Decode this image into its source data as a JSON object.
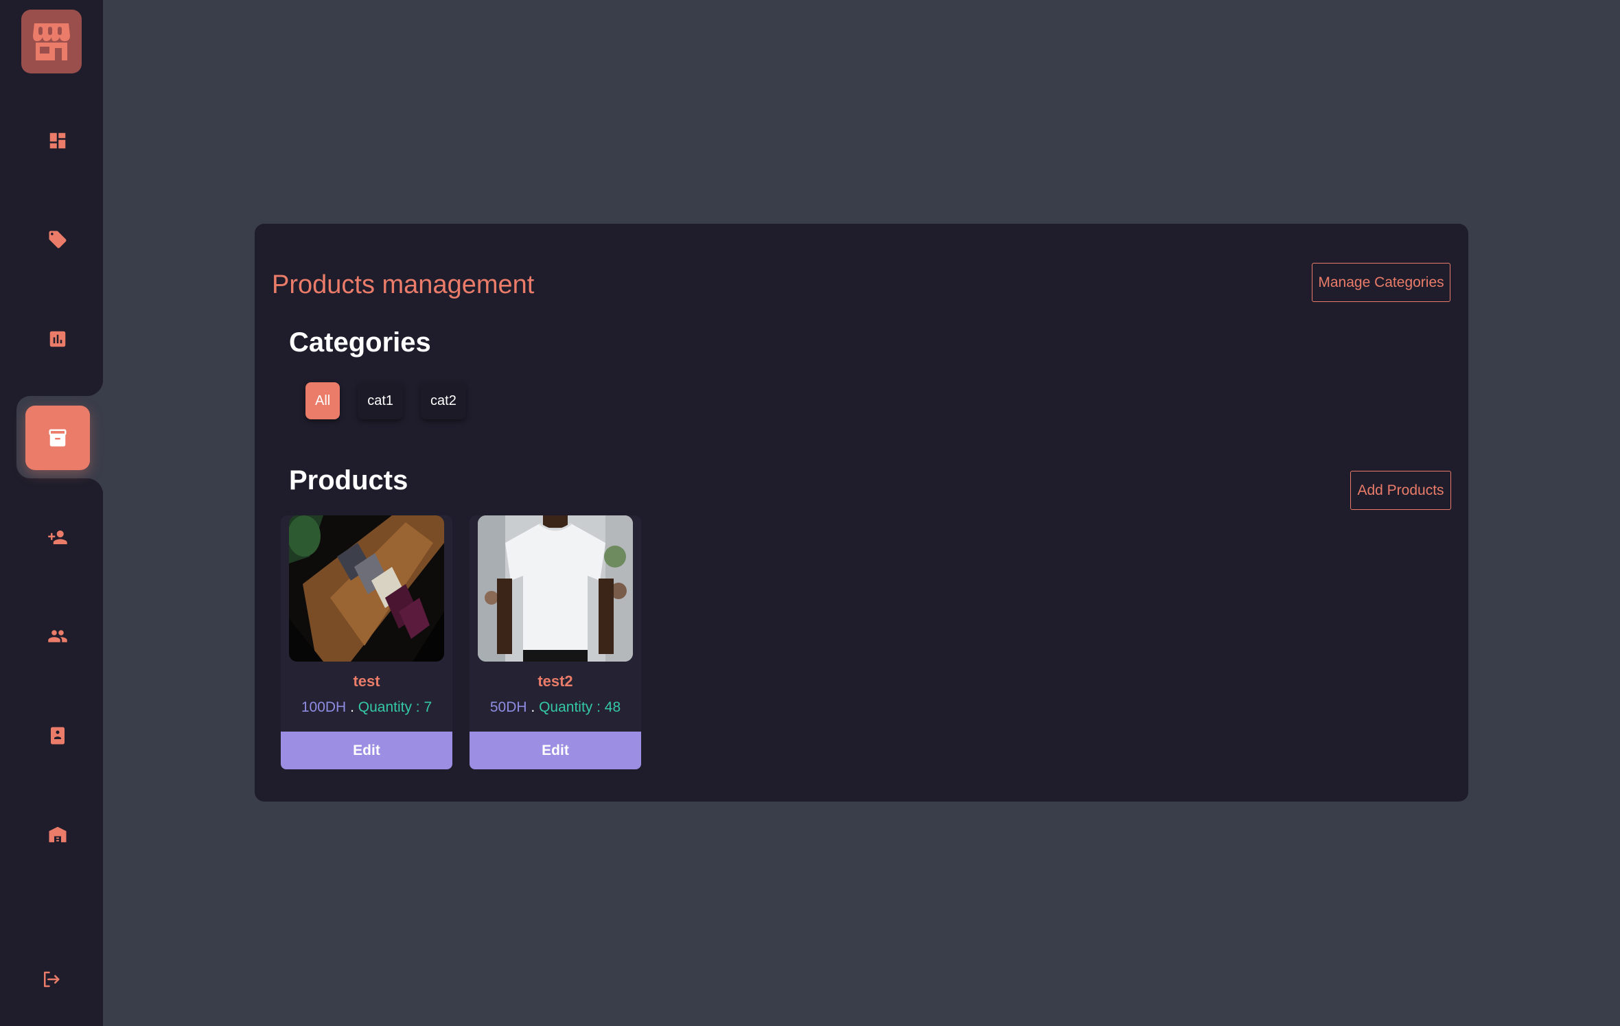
{
  "theme": {
    "accent": "#ea7c69",
    "sidebar_bg": "#1f1d2b",
    "page_bg": "#3a3d4a",
    "panel_bg": "#1f1d2b",
    "edit_button": "#9b8ee3",
    "price_color": "#8f8ce3",
    "quantity_color": "#35c8a5"
  },
  "sidebar": {
    "logo_icon": "storefront-icon",
    "items": [
      {
        "icon": "dashboard-icon",
        "active": false
      },
      {
        "icon": "tag-icon",
        "active": false
      },
      {
        "icon": "bar-chart-icon",
        "active": false
      },
      {
        "icon": "archive-box-icon",
        "active": true
      },
      {
        "icon": "add-user-icon",
        "active": false
      },
      {
        "icon": "users-icon",
        "active": false
      },
      {
        "icon": "document-icon",
        "active": false
      },
      {
        "icon": "warehouse-icon",
        "active": false
      }
    ],
    "logout_icon": "logout-icon"
  },
  "main": {
    "title": "Products management",
    "manage_categories_label": "Manage Categories",
    "categories_heading": "Categories",
    "categories": [
      {
        "label": "All",
        "active": true
      },
      {
        "label": "cat1",
        "active": false
      },
      {
        "label": "cat2",
        "active": false
      }
    ],
    "products_heading": "Products",
    "add_products_label": "Add Products",
    "products": [
      {
        "name": "test",
        "price": "100DH",
        "separator": ".",
        "quantity": "Quantity : 7",
        "edit_label": "Edit",
        "image": "folded-shirts-photo"
      },
      {
        "name": "test2",
        "price": "50DH",
        "separator": ".",
        "quantity": "Quantity : 48",
        "edit_label": "Edit",
        "image": "white-tshirt-photo"
      }
    ]
  }
}
